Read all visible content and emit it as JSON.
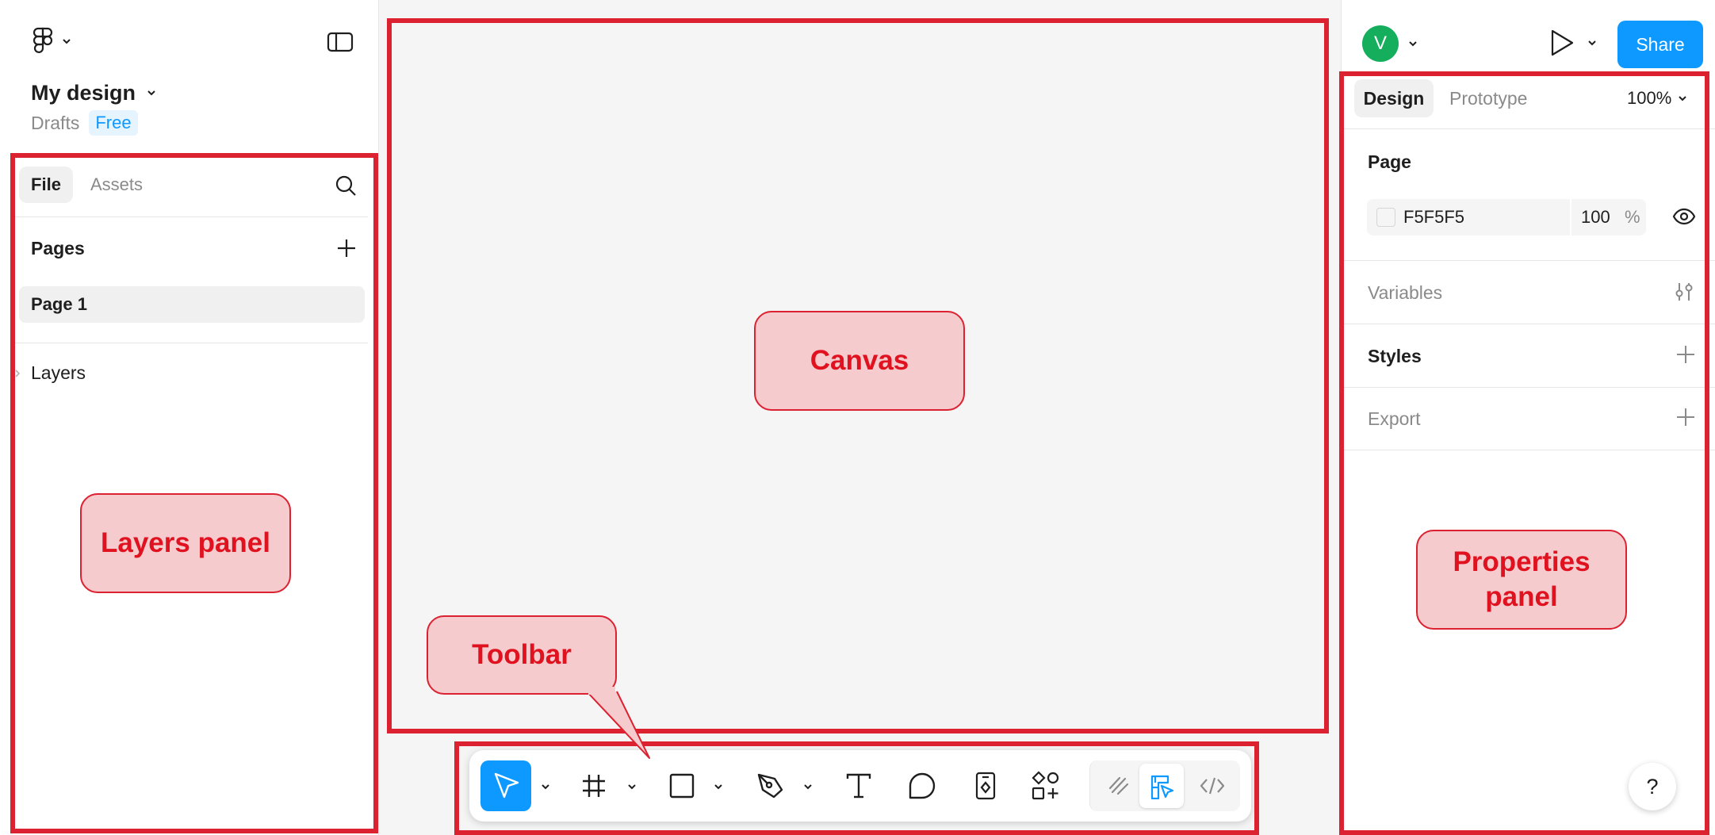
{
  "left_panel": {
    "file_name": "My design",
    "location": "Drafts",
    "plan_badge": "Free",
    "tabs": [
      {
        "label": "File",
        "active": true
      },
      {
        "label": "Assets",
        "active": false
      }
    ],
    "pages_heading": "Pages",
    "pages": [
      {
        "label": "Page 1",
        "selected": true
      }
    ],
    "layers_heading": "Layers"
  },
  "header_right": {
    "avatar_initial": "V",
    "avatar_color": "#14ae5c",
    "share_label": "Share",
    "share_color": "#0d99ff"
  },
  "right_panel": {
    "tabs": [
      {
        "label": "Design",
        "active": true
      },
      {
        "label": "Prototype",
        "active": false
      }
    ],
    "zoom": "100%",
    "page_heading": "Page",
    "page_fill": {
      "hex": "F5F5F5",
      "opacity": "100",
      "unit": "%"
    },
    "sections": [
      {
        "label": "Variables",
        "icon": "variables-icon",
        "muted": true
      },
      {
        "label": "Styles",
        "icon": "plus-icon",
        "muted": false
      },
      {
        "label": "Export",
        "icon": "plus-icon",
        "muted": true
      }
    ],
    "help_label": "?"
  },
  "toolbar": {
    "active_tool": "move",
    "accent": "#0d99ff",
    "tools": [
      "move-icon",
      "frame-icon",
      "rectangle-icon",
      "pen-icon",
      "text-icon",
      "comment-icon",
      "actions-icon",
      "components-icon"
    ],
    "modes": [
      "draw-mode-icon",
      "design-mode-icon",
      "dev-mode-icon"
    ]
  },
  "annotations": {
    "color": "#dc2131",
    "canvas": "Canvas",
    "layers_panel": "Layers panel",
    "toolbar": "Toolbar",
    "properties_line1": "Properties",
    "properties_line2": "panel"
  }
}
